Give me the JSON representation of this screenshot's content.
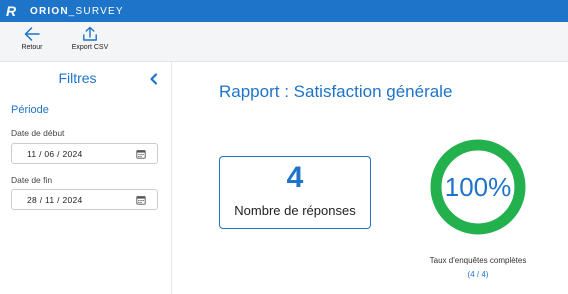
{
  "app": {
    "logo": "R",
    "title_bold": "ORION",
    "title_rest": "_SURVEY"
  },
  "toolbar": {
    "back_label": "Retour",
    "export_label": "Export CSV"
  },
  "sidebar": {
    "title": "Filtres",
    "section": "Période",
    "start_label": "Date de début",
    "start_value": "11 / 06 / 2024",
    "end_label": "Date de fin",
    "end_value": "28 / 11 / 2024"
  },
  "report": {
    "title": "Rapport : Satisfaction générale",
    "responses_count": "4",
    "responses_label": "Nombre de réponses",
    "completion_text": "100%",
    "completion_fraction": 1.0,
    "completion_caption": "Taux d'enquêtes complètes",
    "completion_count": "(4 / 4)"
  },
  "colors": {
    "primary": "#1e74c9",
    "success": "#22b14c",
    "toolbar_bg": "#f4f5f7"
  },
  "icons": {
    "back": "arrow-left-icon",
    "export": "upload-icon",
    "collapse": "chevron-left-icon",
    "calendar": "calendar-icon"
  }
}
